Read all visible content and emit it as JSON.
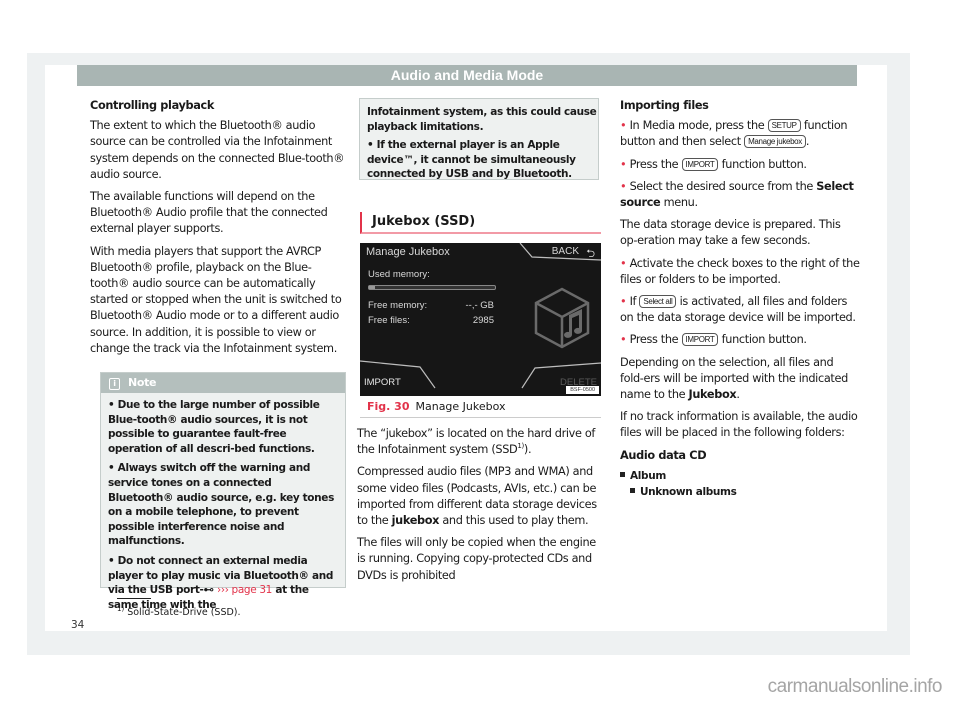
{
  "header": {
    "title": "Audio and Media Mode"
  },
  "col1": {
    "heading": "Controlling playback",
    "p1": "The extent to which the Bluetooth® audio source can be controlled via the Infotainment system depends on the connected Blue-tooth® audio source.",
    "p2": "The available functions will depend on the Bluetooth® Audio profile that the connected external player supports.",
    "p3": "With media players that support the AVRCP Bluetooth® profile, playback on the Blue-tooth® audio source can be automatically started or stopped when the unit is switched to Bluetooth® Audio mode or to a different audio source. In addition, it is possible to view or change the track via the Infotainment system."
  },
  "note": {
    "icon": "info-icon",
    "label": "Note",
    "item1": "• Due to the large number of possible Blue-tooth® audio sources, it is not possible to guarantee fault-free operation of all descri-bed functions.",
    "item2": "• Always switch off the warning and service tones on a connected Bluetooth® audio source, e.g. key tones on a mobile telephone, to prevent possible interference noise and malfunctions.",
    "item3_pre": "• Do not connect an external media player to play music via Bluetooth® and via the USB port",
    "item3_link": "››› page 31",
    "item3_post": "at the same time with the",
    "cont1": "Infotainment system, as this could cause playback limitations.",
    "item4": "• If the external player is an Apple device™, it cannot be simultaneously connected by USB and by Bluetooth."
  },
  "section": {
    "title": "Jukebox (SSD)"
  },
  "screen": {
    "title": "Manage Jukebox",
    "back_label": "BACK",
    "used_memory_label": "Used memory:",
    "used_memory_fraction": 0.05,
    "free_memory_label": "Free memory:",
    "free_memory_value": "--,- GB",
    "free_files_label": "Free files:",
    "free_files_value": "2985",
    "import_label": "IMPORT",
    "delete_label": "DELETE",
    "code": "BSF-0500"
  },
  "figure": {
    "number": "Fig. 30",
    "caption": "Manage Jukebox"
  },
  "col2": {
    "p1_pre": "The “jukebox” is located on the hard drive of the Infotainment system (SSD",
    "p1_sup": "1)",
    "p1_post": ").",
    "p2_pre": "Compressed audio files (MP3 and WMA) and some video files (Podcasts, AVIs, etc.) can be imported from different data storage devices to the",
    "p2_bold": "jukebox",
    "p2_post": "and this used to play them.",
    "p3": "The files will only be copied when the engine is running. Copying copy-protected CDs and DVDs is prohibited"
  },
  "col3": {
    "heading": "Importing files",
    "s1_pre": "In Media mode, press the",
    "s1_key": "SETUP",
    "s1_mid": "function button and then select",
    "s1_key2": "Manage jukebox",
    "s2_pre": "Press the",
    "s2_key": "IMPORT",
    "s2_post": "function button.",
    "s3_pre": "Select the desired source from the",
    "s3_bold": "Select source",
    "s3_post": "menu.",
    "p1": "The data storage device is prepared. This op-eration may take a few seconds.",
    "s4": "Activate the check boxes to the right of the files or folders to be imported.",
    "s5_pre": "If",
    "s5_key": "Select all",
    "s5_post": "is activated, all files and folders on the data storage device will be imported.",
    "s6_pre": "Press the",
    "s6_key": "IMPORT",
    "s6_post": "function button.",
    "p2_pre": "Depending on the selection, all files and fold-ers will be imported with the indicated name to the",
    "p2_bold": "Jukebox",
    "p3": "If no track information is available, the audio files will be placed in the following folders:",
    "sub_heading": "Audio data CD",
    "list1": "Album",
    "list2": "Unknown albums"
  },
  "footnote": {
    "mark": "1)",
    "text": "Solid-State-Drive (SSD)."
  },
  "page_number": "34",
  "watermark": "carmanualsonline.info"
}
